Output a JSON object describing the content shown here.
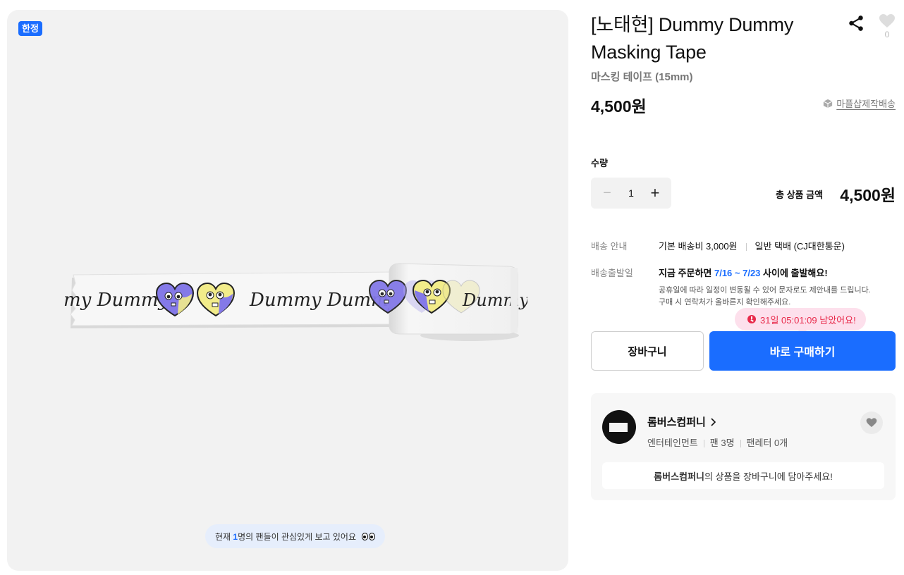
{
  "gallery": {
    "badge": "한정",
    "tape_text_left": "my Dummy",
    "tape_text_mid": "Dummy Dummy",
    "tape_text_roll": "Dummy D",
    "viewers": {
      "prefix": "현재 ",
      "count": "1",
      "suffix": "명의 팬들이 관심있게 보고 있어요"
    }
  },
  "product": {
    "title": "[노태현] Dummy Dummy Masking Tape",
    "subtitle": "마스킹 테이프 (15mm)",
    "price": "4,500원",
    "like_count": "0",
    "shipping_link": "마플샵제작배송"
  },
  "quantity": {
    "label": "수량",
    "value": "1",
    "minus": "−",
    "plus": "+"
  },
  "total": {
    "label": "총 상품 금액",
    "value": "4,500원"
  },
  "delivery": {
    "label": "배송 안내",
    "base_fee": "기본 배송비 3,000원",
    "carrier": "일반 택배 (CJ대한통운)",
    "ship_label": "배송출발일",
    "ship_prefix": "지금 주문하면 ",
    "ship_dates": "7/16 ~ 7/23",
    "ship_suffix": " 사이에 출발해요!",
    "note1": "공휴일에 따라 일정이 변동될 수 있어 문자로도 제안내를 드립니다.",
    "note2": "구매 시 연락처가 올바른지 확인해주세요."
  },
  "countdown": "31일 05:01:09 남았어요!",
  "buttons": {
    "cart": "장바구니",
    "buy": "바로 구매하기"
  },
  "shop": {
    "name": "롬버스컴퍼니",
    "category": "엔터테인먼트",
    "fans": "팬 3명",
    "letters": "팬레터 0개",
    "banner_name": "롬버스컴퍼니",
    "banner_suffix": "의 상품을 장바구니에 담아주세요!"
  },
  "colors": {
    "accent": "#1a6dff",
    "alert": "#e8294a",
    "heart_purple": "#8479e8",
    "heart_yellow": "#f2ec8a"
  }
}
